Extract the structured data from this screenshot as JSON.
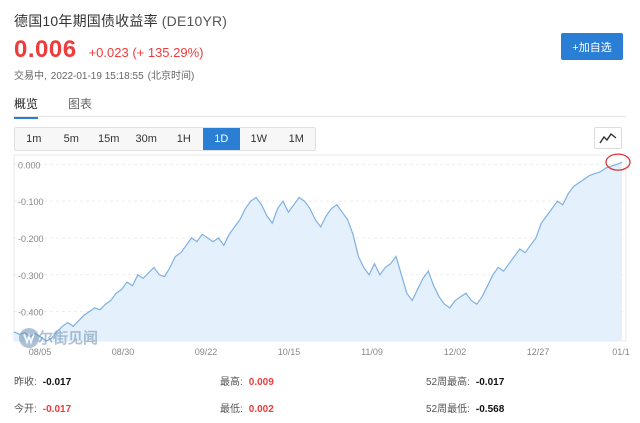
{
  "header": {
    "name": "德国10年期国债收益率",
    "code": "(DE10YR)",
    "price": "0.006",
    "change": "+0.023",
    "change_pct": "(+ 135.29%)",
    "status": "交易中,",
    "datetime": "2022-01-19 15:18:55",
    "timezone": "(北京时间)",
    "add_button": "+加自选"
  },
  "tabs": [
    "概览",
    "图表"
  ],
  "periods": [
    "1m",
    "5m",
    "15m",
    "30m",
    "1H",
    "1D",
    "1W",
    "1M"
  ],
  "active_period": "1D",
  "watermark": "华尔街见闻",
  "colors": {
    "accent": "#2a7fd4",
    "up": "#ee3b3b",
    "line": "#7fb0e2",
    "fill": "#e4f1fc",
    "highlight_circle": "#d9363e"
  },
  "stats": {
    "prev_close_label": "昨收:",
    "prev_close": "-0.017",
    "open_label": "今开:",
    "open": "-0.017",
    "high_label": "最高:",
    "high": "0.009",
    "low_label": "最低:",
    "low": "0.002",
    "w52_high_label": "52周最高:",
    "w52_high": "-0.017",
    "w52_low_label": "52周最低:",
    "w52_low": "-0.568"
  },
  "chart_data": {
    "type": "area",
    "ylim": [
      -0.48,
      0.02
    ],
    "yticks": [
      "0.000",
      "-0.100",
      "-0.200",
      "-0.300",
      "-0.400"
    ],
    "yticks_values": [
      0.0,
      -0.1,
      -0.2,
      -0.3,
      -0.4
    ],
    "xticks": [
      "08/05",
      "08/30",
      "09/22",
      "10/15",
      "11/09",
      "12/02",
      "12/27",
      "01/1"
    ],
    "grid": true,
    "values": [
      -0.455,
      -0.462,
      -0.458,
      -0.468,
      -0.46,
      -0.47,
      -0.48,
      -0.472,
      -0.455,
      -0.44,
      -0.43,
      -0.44,
      -0.425,
      -0.41,
      -0.4,
      -0.39,
      -0.395,
      -0.38,
      -0.37,
      -0.35,
      -0.34,
      -0.32,
      -0.33,
      -0.3,
      -0.31,
      -0.295,
      -0.28,
      -0.3,
      -0.305,
      -0.28,
      -0.25,
      -0.24,
      -0.22,
      -0.2,
      -0.21,
      -0.19,
      -0.2,
      -0.21,
      -0.2,
      -0.22,
      -0.19,
      -0.17,
      -0.15,
      -0.12,
      -0.1,
      -0.09,
      -0.11,
      -0.14,
      -0.16,
      -0.12,
      -0.1,
      -0.13,
      -0.11,
      -0.09,
      -0.1,
      -0.12,
      -0.15,
      -0.17,
      -0.14,
      -0.12,
      -0.11,
      -0.13,
      -0.15,
      -0.19,
      -0.25,
      -0.28,
      -0.3,
      -0.27,
      -0.3,
      -0.28,
      -0.27,
      -0.25,
      -0.3,
      -0.35,
      -0.37,
      -0.34,
      -0.31,
      -0.29,
      -0.33,
      -0.36,
      -0.38,
      -0.39,
      -0.37,
      -0.36,
      -0.35,
      -0.37,
      -0.38,
      -0.36,
      -0.33,
      -0.3,
      -0.28,
      -0.29,
      -0.27,
      -0.25,
      -0.23,
      -0.24,
      -0.22,
      -0.2,
      -0.16,
      -0.14,
      -0.12,
      -0.1,
      -0.11,
      -0.08,
      -0.06,
      -0.05,
      -0.04,
      -0.03,
      -0.025,
      -0.02,
      -0.01,
      -0.005,
      0.0,
      0.006
    ]
  }
}
